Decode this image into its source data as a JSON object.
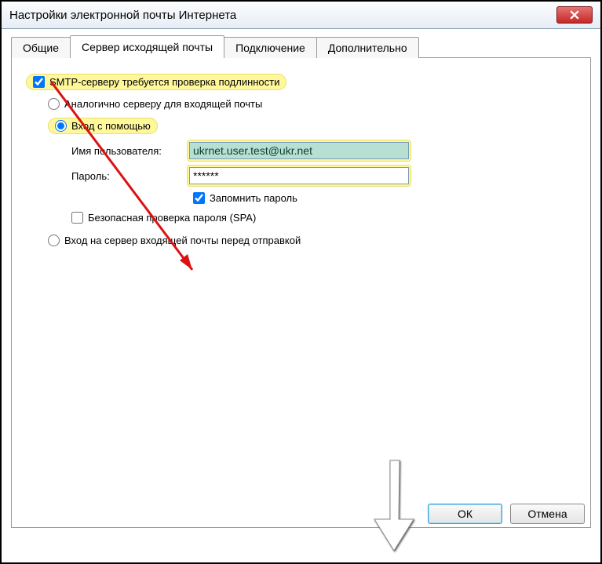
{
  "title": "Настройки электронной почты Интернета",
  "tabs": {
    "general": "Общие",
    "outgoing": "Сервер исходящей почты",
    "connection": "Подключение",
    "advanced": "Дополнительно"
  },
  "panel": {
    "smtp_auth_label": "SMTP-серверу требуется проверка подлинности",
    "smtp_auth_checked": true,
    "opt_same_as_incoming": "Аналогично серверу для входящей почты",
    "opt_login_with": "Вход с помощью",
    "username_label": "Имя пользователя:",
    "username_value": "ukrnet.user.test@ukr.net",
    "password_label": "Пароль:",
    "password_value": "******",
    "remember_password": "Запомнить пароль",
    "remember_password_checked": true,
    "spa_label": "Безопасная проверка пароля (SPA)",
    "spa_checked": false,
    "opt_login_incoming_first": "Вход на сервер входящей почты перед отправкой"
  },
  "buttons": {
    "ok": "ОК",
    "cancel": "Отмена"
  }
}
